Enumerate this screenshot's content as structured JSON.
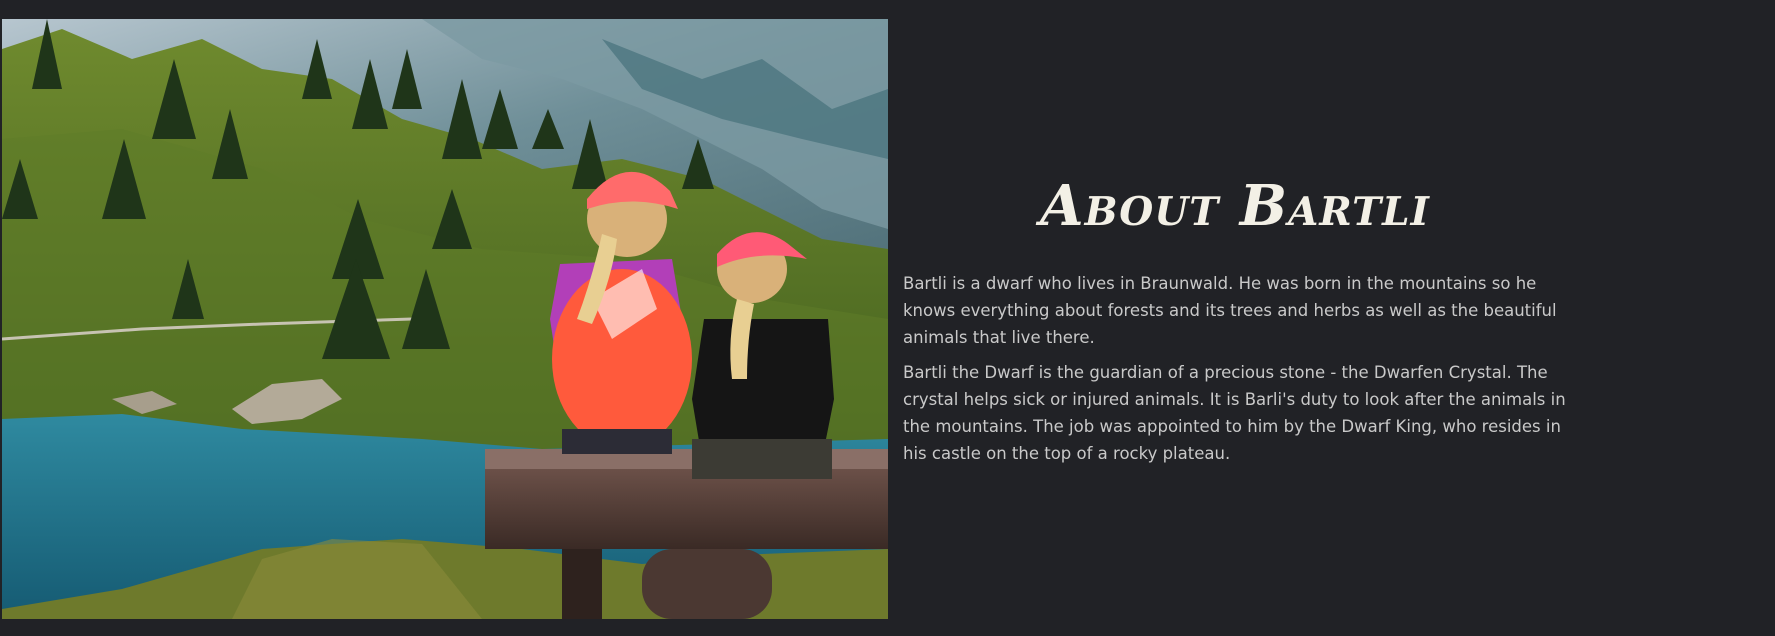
{
  "about": {
    "heading": "About Bartli",
    "paragraphs": [
      "Bartli is a dwarf who lives in Braunwald. He was born in the mountains so he knows everything about forests and its trees and herbs as well as the beautiful animals that live there.",
      "Bartli the Dwarf is the guardian of a precious stone - the Dwarfen Crystal. The crystal helps sick or injured animals. It is Barli's duty to look after the animals in the mountains. The job was appointed to him by the Dwarf King, who resides in his castle on the top of a rocky plateau."
    ]
  },
  "colors": {
    "page_background": "#212226",
    "heading_text": "#f3f0e6",
    "body_text": "#c9c9c9"
  }
}
